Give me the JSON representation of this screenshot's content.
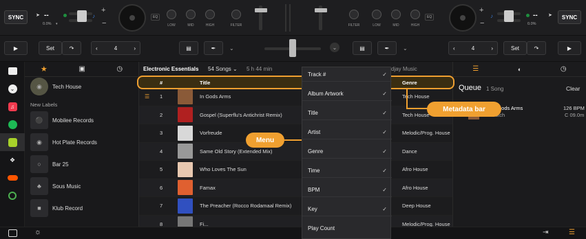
{
  "deck_left": {
    "sync": "SYNC",
    "bpm": "--",
    "pitch": "0.0%",
    "key": "--"
  },
  "deck_right": {
    "sync": "SYNC",
    "bpm": "--",
    "pitch": "0.0%",
    "key": "--"
  },
  "mixer": {
    "eq_tag": "EQ",
    "knob_labels_left": [
      "LOW",
      "MID",
      "HIGH",
      "FILTER"
    ],
    "knob_labels_right": [
      "FILTER",
      "LOW",
      "MID",
      "HIGH"
    ]
  },
  "transport": {
    "set": "Set",
    "loop_value": "4"
  },
  "sidebar": {
    "items": [
      {
        "label": "Tech House"
      },
      {
        "label": "Mobilee Records"
      },
      {
        "label": "Hot Plate Records"
      },
      {
        "label": "Bar 25"
      },
      {
        "label": "Sous Music"
      },
      {
        "label": "Klub Record"
      }
    ],
    "section": "New Labels"
  },
  "playlist": {
    "title": "Electronic Essentials",
    "songs": "54 Songs",
    "duration": "5 h 44 min",
    "search_placeholder": "djay Music",
    "columns": {
      "num": "#",
      "title": "Title",
      "genre": "Genre"
    },
    "rows": [
      {
        "n": "1",
        "title": "In Gods Arms",
        "genre": "Tech House",
        "color": "#8a5a38"
      },
      {
        "n": "2",
        "title": "Gospel (Superflu's Antichrist Remix)",
        "genre": "Tech House",
        "color": "#b02020"
      },
      {
        "n": "3",
        "title": "Vorfreude",
        "genre": "Melodic/Prog. House",
        "color": "#d8d8d8"
      },
      {
        "n": "4",
        "title": "Same Old Story (Extended Mix)",
        "genre": "Dance",
        "color": "#999"
      },
      {
        "n": "5",
        "title": "Who Loves The Sun",
        "genre": "Afro House",
        "color": "#e8c8b0"
      },
      {
        "n": "6",
        "title": "Famax",
        "genre": "Afro House",
        "color": "#e06030"
      },
      {
        "n": "7",
        "title": "The Preacher (Rocco Rodamaal Remix)",
        "genre": "Deep House",
        "color": "#3050c0"
      },
      {
        "n": "8",
        "title": "Fi...",
        "genre": "Melodic/Prog. House",
        "color": "#777"
      }
    ]
  },
  "menu": {
    "items": [
      {
        "label": "Track #",
        "checked": true
      },
      {
        "label": "Album Artwork",
        "checked": true
      },
      {
        "label": "Title",
        "checked": true
      },
      {
        "label": "Artist",
        "checked": true
      },
      {
        "label": "Genre",
        "checked": true
      },
      {
        "label": "Time",
        "checked": true
      },
      {
        "label": "BPM",
        "checked": true
      },
      {
        "label": "Key",
        "checked": true
      },
      {
        "label": "Play Count",
        "checked": false
      }
    ]
  },
  "queue": {
    "title": "Queue",
    "count": "1 Song",
    "clear": "Clear",
    "item_title": "In Gods Arms",
    "item_artist": "Sutch",
    "item_bpm": "126 BPM",
    "item_key": "C 09.0m"
  },
  "callouts": {
    "menu": "Menu",
    "metadata_bar": "Metadata bar"
  },
  "colors": {
    "accent": "#f0a030",
    "blue": "#3a7bd5"
  }
}
